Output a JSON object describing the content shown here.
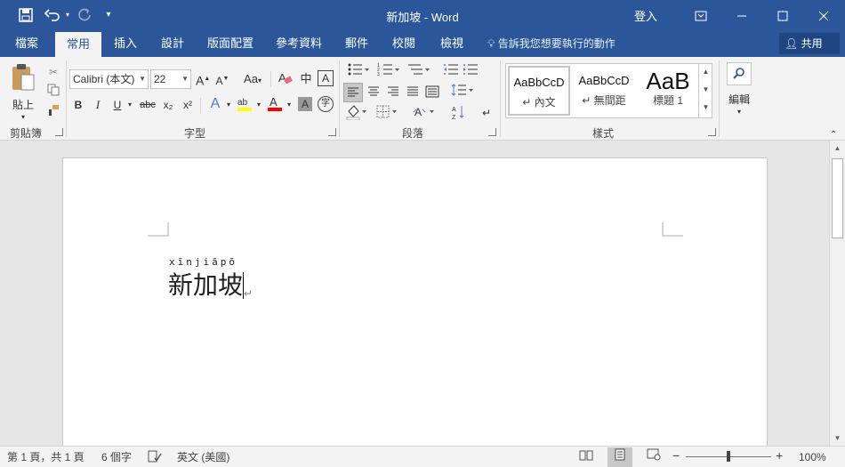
{
  "titlebar": {
    "title": "新加坡 - Word",
    "signin": "登入",
    "save_icon": "save-icon",
    "undo_icon": "undo-icon",
    "redo_icon": "redo-icon"
  },
  "tabs": [
    "檔案",
    "常用",
    "插入",
    "設計",
    "版面配置",
    "參考資料",
    "郵件",
    "校閱",
    "檢視"
  ],
  "active_tab": "常用",
  "tellme": "告訴我您想要執行的動作",
  "share": "共用",
  "ribbon": {
    "clipboard": {
      "label": "剪貼簿",
      "paste": "貼上"
    },
    "font": {
      "label": "字型",
      "font_name": "Calibri (本文)",
      "font_size": "22",
      "case": "Aa",
      "phonetic": "中",
      "border_char": "A",
      "bold": "B",
      "italic": "I",
      "underline": "U",
      "strike": "abc",
      "sub": "x₂",
      "sup": "x²",
      "text_effect": "A",
      "color_a": "A",
      "shade_a": "A",
      "enclose": "字"
    },
    "paragraph": {
      "label": "段落"
    },
    "styles": {
      "label": "樣式",
      "items": [
        {
          "preview": "AaBbCcD",
          "name": "↵ 內文"
        },
        {
          "preview": "AaBbCcD",
          "name": "↵ 無間距"
        },
        {
          "preview": "AaB",
          "name": "標題 1"
        }
      ]
    },
    "editing": {
      "label": "編輯"
    }
  },
  "document": {
    "ruby": "xīnjiāpō",
    "text": "新加坡",
    "pilcrow": "↵"
  },
  "statusbar": {
    "page": "第 1 頁，共 1 頁",
    "words": "6 個字",
    "language": "英文 (美國)",
    "zoom": "100%",
    "zoom_minus": "−",
    "zoom_plus": "+"
  },
  "colors": {
    "accent": "#2b579a",
    "highlight": "#ffff00",
    "font_color": "#ff0000"
  }
}
